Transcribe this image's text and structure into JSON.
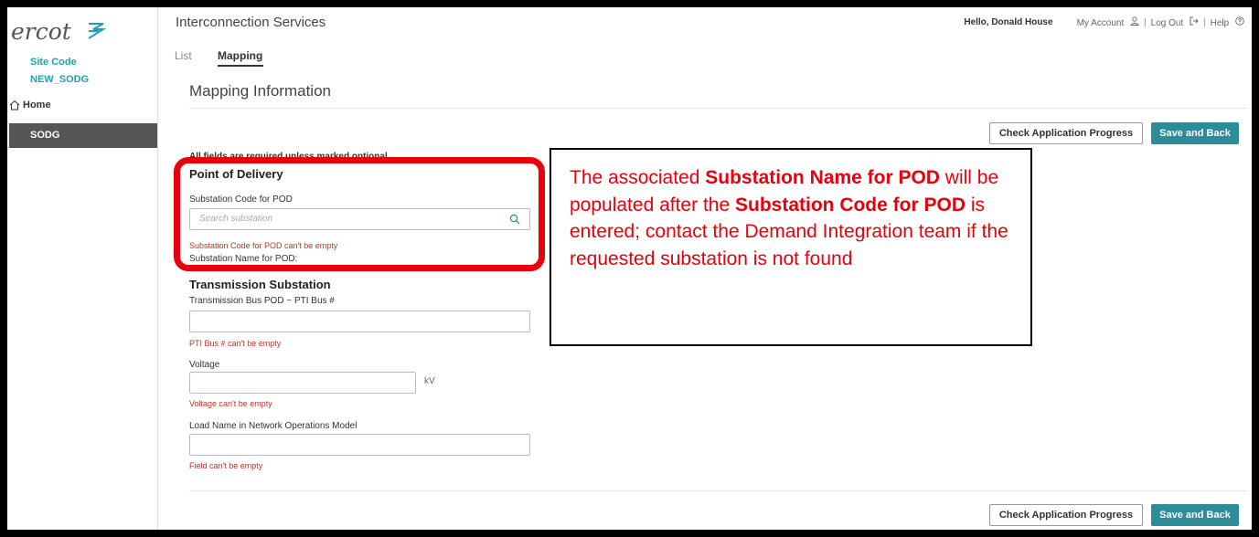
{
  "sidebar": {
    "logo_text": "ercot",
    "site_code_label": "Site Code",
    "site_code_value": "NEW_SODG",
    "home_label": "Home",
    "active_item": "SODG"
  },
  "header": {
    "app_title": "Interconnection Services",
    "greeting": "Hello, Donald House",
    "my_account": "My Account",
    "log_out": "Log Out",
    "help": "Help",
    "separator": "|"
  },
  "tabs": [
    {
      "label": "List",
      "active": false
    },
    {
      "label": "Mapping",
      "active": true
    }
  ],
  "section_title": "Mapping Information",
  "buttons": {
    "check_progress": "Check Application Progress",
    "save_back": "Save and Back"
  },
  "form": {
    "required_note": "All fields are required unless marked optional",
    "pod_heading": "Point of Delivery",
    "substation_code_label": "Substation Code for POD",
    "substation_code_placeholder": "Search substation",
    "substation_code_error": "Substation Code for POD can't be empty",
    "substation_name_label": "Substation Name for POD:",
    "transmission_heading": "Transmission Substation",
    "pti_bus_label": "Transmission Bus POD ~ PTI Bus #",
    "pti_bus_error": "PTI Bus # can't be empty",
    "voltage_label": "Voltage",
    "voltage_unit": "kV",
    "voltage_error": "Voltage can't be empty",
    "load_name_label": "Load Name in Network Operations Model",
    "load_name_error": "Field can't be empty"
  },
  "callout": {
    "part1": "The associated ",
    "bold1": "Substation Name for POD",
    "part2": " will be populated after the ",
    "bold2": "Substation Code for POD",
    "part3": " is entered; contact the Demand Integration team if the requested substation is not found"
  },
  "colors": {
    "accent_teal": "#2c8c98",
    "site_code_cyan": "#1fa1b3",
    "error_red": "#b03a2e",
    "annotation_red": "#e8000d"
  }
}
